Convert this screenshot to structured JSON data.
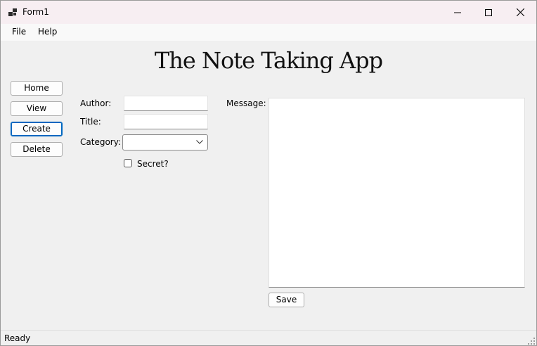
{
  "window": {
    "title": "Form1"
  },
  "menu": {
    "file": "File",
    "help": "Help"
  },
  "app_title": "The Note Taking App",
  "nav": {
    "home": "Home",
    "view": "View",
    "create": "Create",
    "delete": "Delete",
    "focused": "create"
  },
  "form": {
    "author_label": "Author:",
    "author_value": "",
    "title_label": "Title:",
    "title_value": "",
    "category_label": "Category:",
    "category_value": "",
    "secret_label": "Secret?",
    "secret_checked": false,
    "message_label": "Message:",
    "message_value": "",
    "save_label": "Save"
  },
  "status": {
    "text": "Ready"
  },
  "icons": {
    "app": "app-icon",
    "minimize": "minimize-icon",
    "maximize": "maximize-icon",
    "close": "close-icon",
    "dropdown": "chevron-down-icon",
    "grip": "resize-grip-icon"
  },
  "colors": {
    "focus_border": "#0067c0",
    "titlebar": "#f7eef2",
    "window_bg": "#f0f0f0"
  }
}
